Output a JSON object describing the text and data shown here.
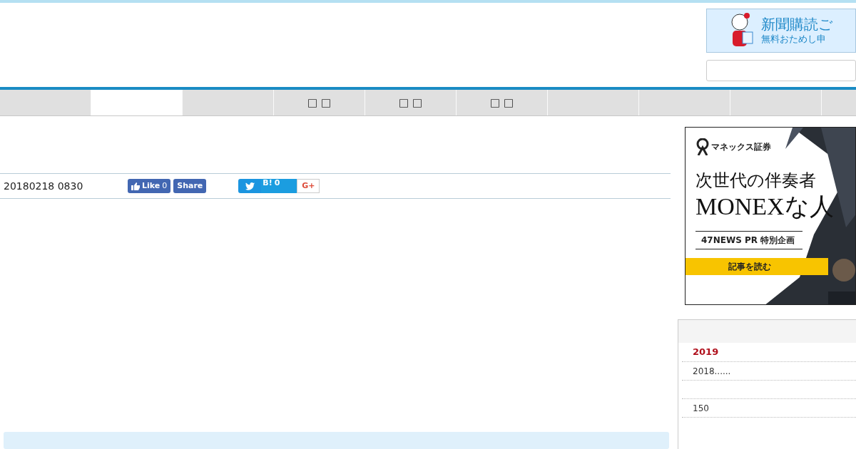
{
  "header": {
    "banner_ad": {
      "headline": "新聞購読ご",
      "subline": "無料おためし申"
    }
  },
  "nav_tabs": [
    {
      "selected": false
    },
    {
      "selected": true
    },
    {
      "selected": false
    },
    {
      "label": "□ □",
      "selected": false
    },
    {
      "label": "□ □",
      "selected": false
    },
    {
      "label": "□ □",
      "selected": false
    },
    {
      "selected": false
    },
    {
      "selected": false
    },
    {
      "selected": false
    }
  ],
  "article": {
    "date": "20180218 0830",
    "share": {
      "like_label": "Like",
      "like_count": "0",
      "share_label": "Share",
      "hatena_label": "B!",
      "hatena_count": "0",
      "gplus_label": "G+"
    }
  },
  "side_ad": {
    "brand": "マネックス証券",
    "line1": "次世代の伴奏者",
    "line2": "MONEXな人",
    "tag": "47NEWS PR 特別企画",
    "cta": "記事を読む"
  },
  "archive": {
    "items": [
      {
        "text": "2019",
        "selected": true
      },
      {
        "text": "2018......",
        "selected": false
      },
      {
        "selected": false
      },
      {
        "text": "150",
        "selected": false
      }
    ]
  }
}
